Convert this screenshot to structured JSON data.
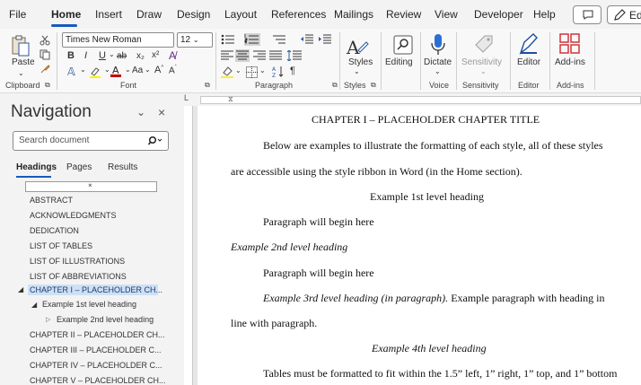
{
  "menu_tabs": [
    "File",
    "Home",
    "Insert",
    "Draw",
    "Design",
    "Layout",
    "References",
    "Mailings",
    "Review",
    "View",
    "Developer",
    "Help"
  ],
  "edit_label": "Edit",
  "ribbon": {
    "paste_label": "Paste",
    "font_name": "Times New Roman",
    "font_size": "12",
    "styles_label": "Styles",
    "editing_label": "Editing",
    "dictate_label": "Dictate",
    "sensitivity_label": "Sensitivity",
    "editor_label": "Editor",
    "addins_label": "Add-ins",
    "groups": [
      "Clipboard",
      "Font",
      "Paragraph",
      "Styles",
      "Voice",
      "Sensitivity",
      "Editor",
      "Add-ins"
    ]
  },
  "navigation": {
    "title": "Navigation",
    "search_placeholder": "Search document",
    "tabs": [
      "Headings",
      "Pages",
      "Results"
    ],
    "headings": [
      "ABSTRACT",
      "ACKNOWLEDGMENTS",
      "DEDICATION",
      "LIST OF TABLES",
      "LIST OF ILLUSTRATIONS",
      "LIST OF ABBREVIATIONS",
      "CHAPTER I – PLACEHOLDER CH...",
      "Example 1st level heading",
      "Example 2nd level heading",
      "CHAPTER II – PLACEHOLDER CH...",
      "CHAPTER III – PLACEHOLDER C...",
      "CHAPTER IV – PLACEHOLDER C...",
      "CHAPTER V – PLACEHOLDER CH..."
    ]
  },
  "document": {
    "chapter_title": "CHAPTER I – PLACEHOLDER CHAPTER TITLE",
    "line1": "Below are examples to illustrate the formatting of each style, all of these styles",
    "line2": "are accessible using the style ribbon in Word (in the Home section).",
    "heading1": "Example 1st level heading",
    "para1": "Paragraph will begin here",
    "heading2": "Example 2nd level heading",
    "para2": "Paragraph will begin here",
    "heading3": "Example 3rd level heading (in paragraph).",
    "heading3_follow": "Example paragraph with heading in",
    "line_cont": "line with paragraph.",
    "heading4": "Example 4th level heading",
    "tables_line": "Tables must be formatted to fit within the 1.5” left, 1” right, 1” top, and 1” bottom"
  }
}
